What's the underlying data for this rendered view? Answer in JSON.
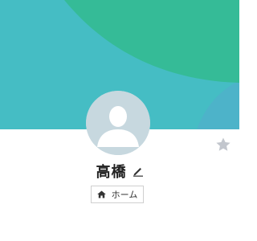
{
  "colors": {
    "cover_base": "#45bdc4",
    "cover_wave": "#35bb97",
    "cover_shade": "#4db3c9",
    "avatar_bg": "#c7d8df",
    "avatar_silhouette": "#ffffff",
    "star": "#c2c6cd",
    "text": "#222222",
    "border": "#cfcfcf"
  },
  "profile": {
    "name": "高橋",
    "edit_icon": "pencil-icon",
    "avatar_icon": "default-user-silhouette",
    "favorite_icon": "star-icon"
  },
  "actions": {
    "home_label": "ホーム",
    "home_icon": "home-icon"
  }
}
